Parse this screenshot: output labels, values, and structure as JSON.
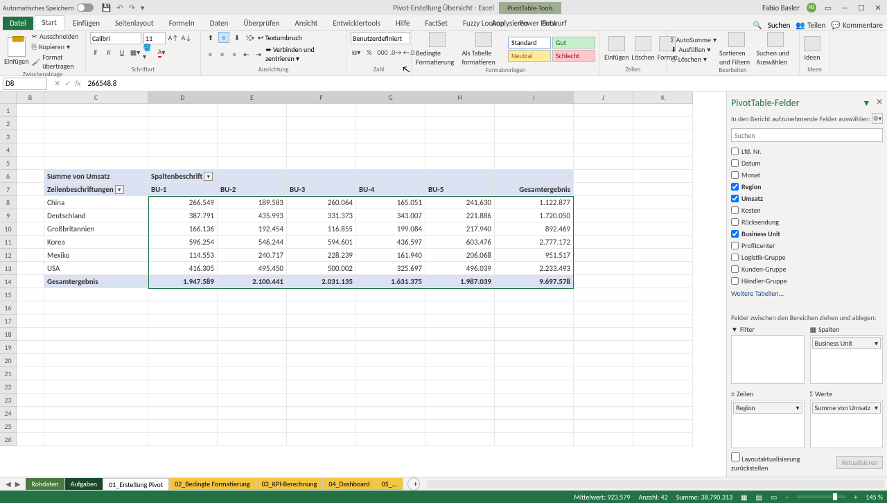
{
  "title": "Pivot-Erstellung Übersicht  -  Excel",
  "pivot_tools": "PivotTable-Tools",
  "user_name": "Fabio Basler",
  "user_initials": "FB",
  "autosave_label": "Automatisches Speichern",
  "tabs": {
    "datei": "Datei",
    "start": "Start",
    "einfuegen": "Einfügen",
    "seitenlayout": "Seitenlayout",
    "formeln": "Formeln",
    "daten": "Daten",
    "ueberpruefen": "Überprüfen",
    "ansicht": "Ansicht",
    "entwicklertools": "Entwicklertools",
    "hilfe": "Hilfe",
    "factset": "FactSet",
    "fuzzy": "Fuzzy Lookup",
    "powerpivot": "Power Pivot",
    "analysieren": "Analysieren",
    "entwurf": "Entwurf",
    "suchen": "Suchen",
    "teilen": "Teilen",
    "kommentare": "Kommentare"
  },
  "ribbon": {
    "zwischenablage": "Zwischenablage",
    "einfuegen_btn": "Einfügen",
    "ausschneiden": "Ausschneiden",
    "kopieren": "Kopieren",
    "format_ueb": "Format übertragen",
    "schriftart": "Schriftart",
    "font": "Calibri",
    "size": "11",
    "ausrichtung": "Ausrichtung",
    "textumbruch": "Textumbruch",
    "verbinden": "Verbinden und zentrieren",
    "zahl": "Zahl",
    "numfmt": "Benutzerdefiniert",
    "bedingte": "Bedingte Formatierung",
    "als_tabelle": "Als Tabelle formatieren",
    "formatvorlagen": "Formatvorlagen",
    "style_standard": "Standard",
    "style_gut": "Gut",
    "style_neutral": "Neutral",
    "style_schlecht": "Schlecht",
    "zellen": "Zellen",
    "z_einfuegen": "Einfügen",
    "z_loeschen": "Löschen",
    "z_format": "Format",
    "bearbeiten": "Bearbeiten",
    "autosumme": "AutoSumme",
    "ausfuellen": "Ausfüllen",
    "loeschen": "Löschen",
    "sortieren": "Sortieren und Filtern",
    "suchen_aus": "Suchen und Auswählen",
    "ideen": "Ideen",
    "ideen_grp": "Ideen"
  },
  "namebox": "D8",
  "formula": "266548,8",
  "cols": [
    "B",
    "C",
    "D",
    "E",
    "F",
    "G",
    "H",
    "I",
    "J",
    "K"
  ],
  "pivot": {
    "measure": "Summe von Umsatz",
    "col_label": "Spaltenbeschrift",
    "row_label": "Zeilenbeschriftungen",
    "bus": [
      "BU-1",
      "BU-2",
      "BU-3",
      "BU-4",
      "BU-5"
    ],
    "grand": "Gesamtergebnis",
    "rows": [
      "China",
      "Deutschland",
      "Großbritannien",
      "Korea",
      "Mexiko",
      "USA"
    ],
    "chart_data": {
      "type": "table",
      "row_field": "Region",
      "col_field": "Business Unit",
      "rows": [
        "China",
        "Deutschland",
        "Großbritannien",
        "Korea",
        "Mexiko",
        "USA"
      ],
      "cols": [
        "BU-1",
        "BU-2",
        "BU-3",
        "BU-4",
        "BU-5"
      ],
      "values": [
        [
          266549,
          189583,
          260064,
          165051,
          241630
        ],
        [
          387791,
          435993,
          331373,
          343007,
          221886
        ],
        [
          166136,
          192454,
          116855,
          199084,
          217940
        ],
        [
          596254,
          546244,
          594601,
          436597,
          603476
        ],
        [
          114553,
          240717,
          228239,
          161940,
          206068
        ],
        [
          416305,
          495450,
          500002,
          325697,
          496039
        ]
      ],
      "row_totals": [
        1122877,
        1720050,
        892469,
        2777172,
        951517,
        2233493
      ],
      "col_totals": [
        1947589,
        2100441,
        2031135,
        1631375,
        1987039
      ],
      "grand_total": 9697578
    },
    "data": {
      "China": [
        "266.549",
        "189.583",
        "260.064",
        "165.051",
        "241.630",
        "1.122.877"
      ],
      "Deutschland": [
        "387.791",
        "435.993",
        "331.373",
        "343.007",
        "221.886",
        "1.720.050"
      ],
      "Großbritannien": [
        "166.136",
        "192.454",
        "116.855",
        "199.084",
        "217.940",
        "892.469"
      ],
      "Korea": [
        "596.254",
        "546.244",
        "594.601",
        "436.597",
        "603.476",
        "2.777.172"
      ],
      "Mexiko": [
        "114.553",
        "240.717",
        "228.239",
        "161.940",
        "206.068",
        "951.517"
      ],
      "USA": [
        "416.305",
        "495.450",
        "500.002",
        "325.697",
        "496.039",
        "2.233.493"
      ]
    },
    "totals": [
      "1.947.589",
      "2.100.441",
      "2.031.135",
      "1.631.375",
      "1.987.039",
      "9.697.578"
    ]
  },
  "fieldpane": {
    "title": "PivotTable-Felder",
    "subtitle": "In den Bericht aufzunehmende Felder auswählen:",
    "search": "Suchen",
    "fields": [
      {
        "label": "Lfd. Nr.",
        "checked": false
      },
      {
        "label": "Datum",
        "checked": false
      },
      {
        "label": "Monat",
        "checked": false
      },
      {
        "label": "Region",
        "checked": true
      },
      {
        "label": "Umsatz",
        "checked": true
      },
      {
        "label": "Kosten",
        "checked": false
      },
      {
        "label": "Rücksendung",
        "checked": false
      },
      {
        "label": "Business Unit",
        "checked": true
      },
      {
        "label": "Profitcenter",
        "checked": false
      },
      {
        "label": "Logistik-Gruppe",
        "checked": false
      },
      {
        "label": "Kunden-Gruppe",
        "checked": false
      },
      {
        "label": "Händler-Gruppe",
        "checked": false
      }
    ],
    "more_tables": "Weitere Tabellen...",
    "drag_title": "Felder zwischen den Bereichen ziehen und ablegen:",
    "zones": {
      "filter": "Filter",
      "spalten": "Spalten",
      "zeilen": "Zeilen",
      "werte": "Werte"
    },
    "spalten_item": "Business Unit",
    "zeilen_item": "Region",
    "werte_item": "Summe von Umsatz",
    "defer": "Layoutaktualisierung zurückstellen",
    "update": "Aktualisieren"
  },
  "sheets": {
    "rohdaten": "Rohdaten",
    "aufgaben": "Aufgaben",
    "s1": "01_Erstellung Pivot",
    "s2": "02_Bedingte Formatierung",
    "s3": "03_KPI-Berechnung",
    "s4": "04_Dashboard",
    "s5": "05_..."
  },
  "status": {
    "mittelwert": "Mittelwert: 923.579",
    "anzahl": "Anzahl: 42",
    "summe": "Summe: 38.790.313",
    "zoom": "145 %"
  }
}
